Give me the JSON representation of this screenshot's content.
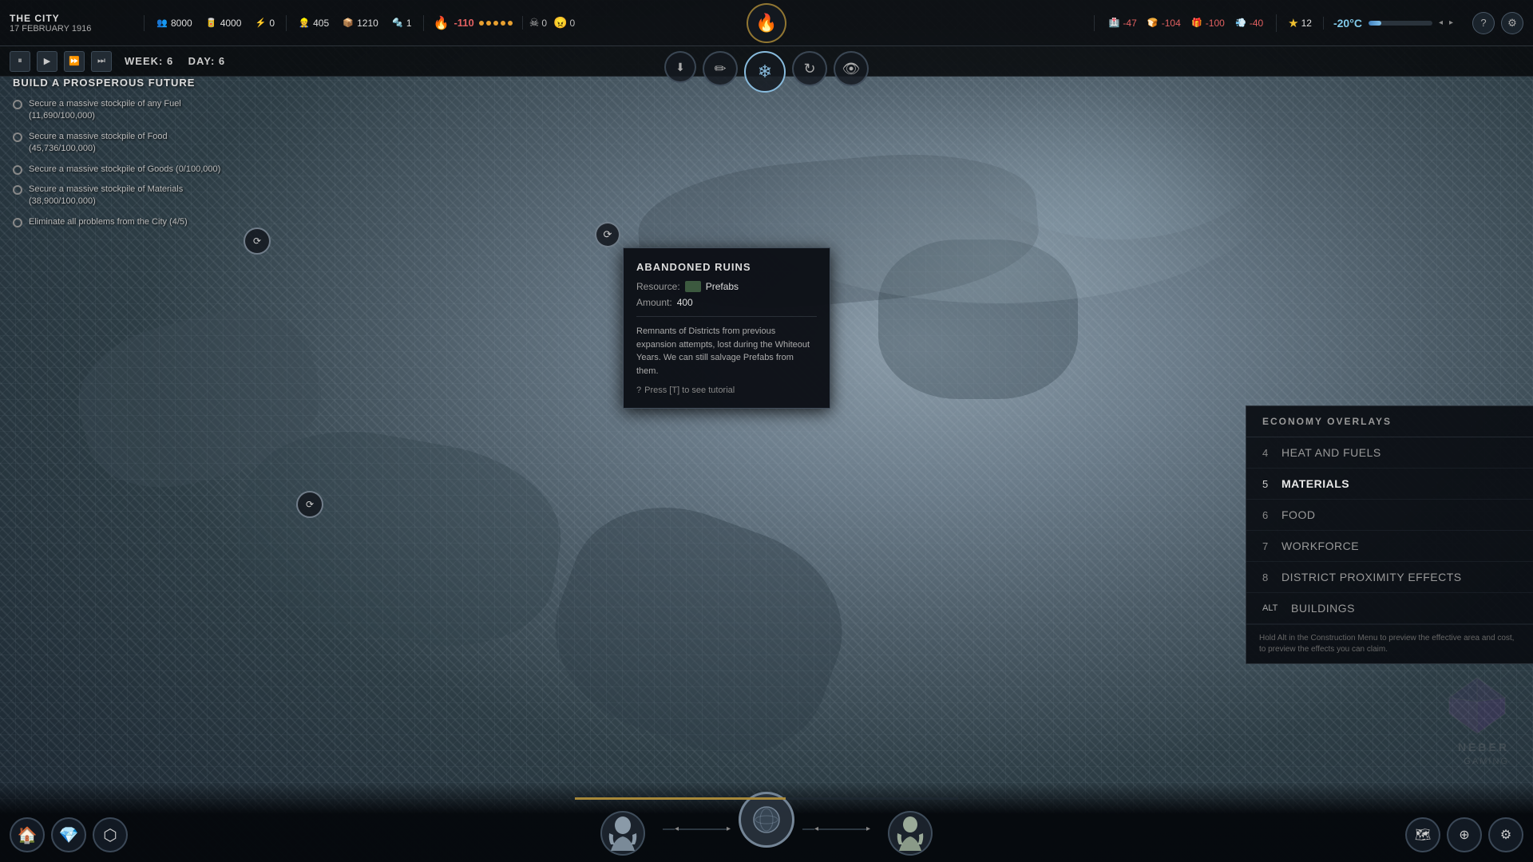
{
  "game": {
    "city_name": "THE CITY",
    "date": "17 FEBRUARY 1916",
    "week_label": "WEEK:",
    "week_value": "6",
    "day_label": "DAY:",
    "day_value": "6"
  },
  "resources": {
    "population": {
      "icon": "👥",
      "value": "8000"
    },
    "food_res": {
      "icon": "🥫",
      "value": "4000"
    },
    "unknown": {
      "icon": "⚡",
      "value": "0"
    },
    "workers": {
      "icon": "👷",
      "value": "405"
    },
    "materials": {
      "icon": "📦",
      "value": "1210"
    },
    "prefabs": {
      "icon": "🔩",
      "value": "1"
    }
  },
  "heat": {
    "value": "-110",
    "dots_filled": 5,
    "dots_total": 5
  },
  "status": {
    "sick": {
      "icon": "☠",
      "value": "0"
    },
    "discontent": {
      "icon": "😠",
      "value": "0"
    }
  },
  "right_resources": {
    "health": {
      "icon": "🏥",
      "value": "-47"
    },
    "food": {
      "icon": "🍞",
      "value": "-104"
    },
    "goods": {
      "icon": "📦",
      "value": "-100"
    },
    "steam": {
      "icon": "💨",
      "value": "-40"
    }
  },
  "star_count": "12",
  "temperature": {
    "display": "-20°C",
    "bar_fill": 20
  },
  "playback": {
    "btn_pause": "⏸",
    "btn_play": "▶",
    "btn_fast": "⏩",
    "btn_fastest": "⏭"
  },
  "nav_icons": [
    {
      "id": "nav-down",
      "icon": "⬇",
      "label": "down-icon"
    },
    {
      "id": "nav-edit",
      "icon": "✏",
      "label": "edit-icon"
    },
    {
      "id": "nav-snowflake",
      "icon": "❄",
      "label": "snowflake-icon",
      "active": true
    },
    {
      "id": "nav-recycle",
      "icon": "↻",
      "label": "recycle-icon"
    },
    {
      "id": "nav-eye",
      "icon": "👁",
      "label": "eye-icon"
    }
  ],
  "objectives": {
    "title": "BUILD A PROSPEROUS FUTURE",
    "items": [
      {
        "text": "Secure a massive stockpile of any Fuel (11,690/100,000)"
      },
      {
        "text": "Secure a massive stockpile of Food (45,736/100,000)"
      },
      {
        "text": "Secure a massive stockpile of Goods (0/100,000)"
      },
      {
        "text": "Secure a massive stockpile of Materials (38,900/100,000)"
      },
      {
        "text": "Eliminate all problems from the City (4/5)"
      }
    ]
  },
  "tooltip": {
    "title": "ABANDONED RUINS",
    "resource_label": "Resource:",
    "resource_value": "Prefabs",
    "amount_label": "Amount:",
    "amount_value": "400",
    "description": "Remnants of Districts from previous expansion attempts, lost during the Whiteout Years. We can still salvage Prefabs from them.",
    "hint": "Press [T] to see tutorial"
  },
  "economy_overlays": {
    "header": "ECONOMY OVERLAYS",
    "items": [
      {
        "number": "4",
        "label": "HEAT AND FUELS",
        "active": false
      },
      {
        "number": "5",
        "label": "MATERIALS",
        "active": true
      },
      {
        "number": "6",
        "label": "FOOD",
        "active": false
      },
      {
        "number": "7",
        "label": "WORKFORCE",
        "active": false
      },
      {
        "number": "8",
        "label": "DISTRICT PROXIMITY EFFECTS",
        "active": false
      }
    ],
    "alt_item": {
      "number": "ALT",
      "label": "BUILDINGS",
      "active": false
    },
    "hint_text": "Hold Alt in the Construction Menu to preview the effective area and cost, to preview the effects you can claim."
  },
  "watermark": {
    "studio": "NEBER",
    "type": "GAMING"
  },
  "bottom_chars": [
    {
      "icon": "🧔",
      "name": "char1"
    },
    {
      "icon": "👤",
      "name": "char2"
    }
  ]
}
